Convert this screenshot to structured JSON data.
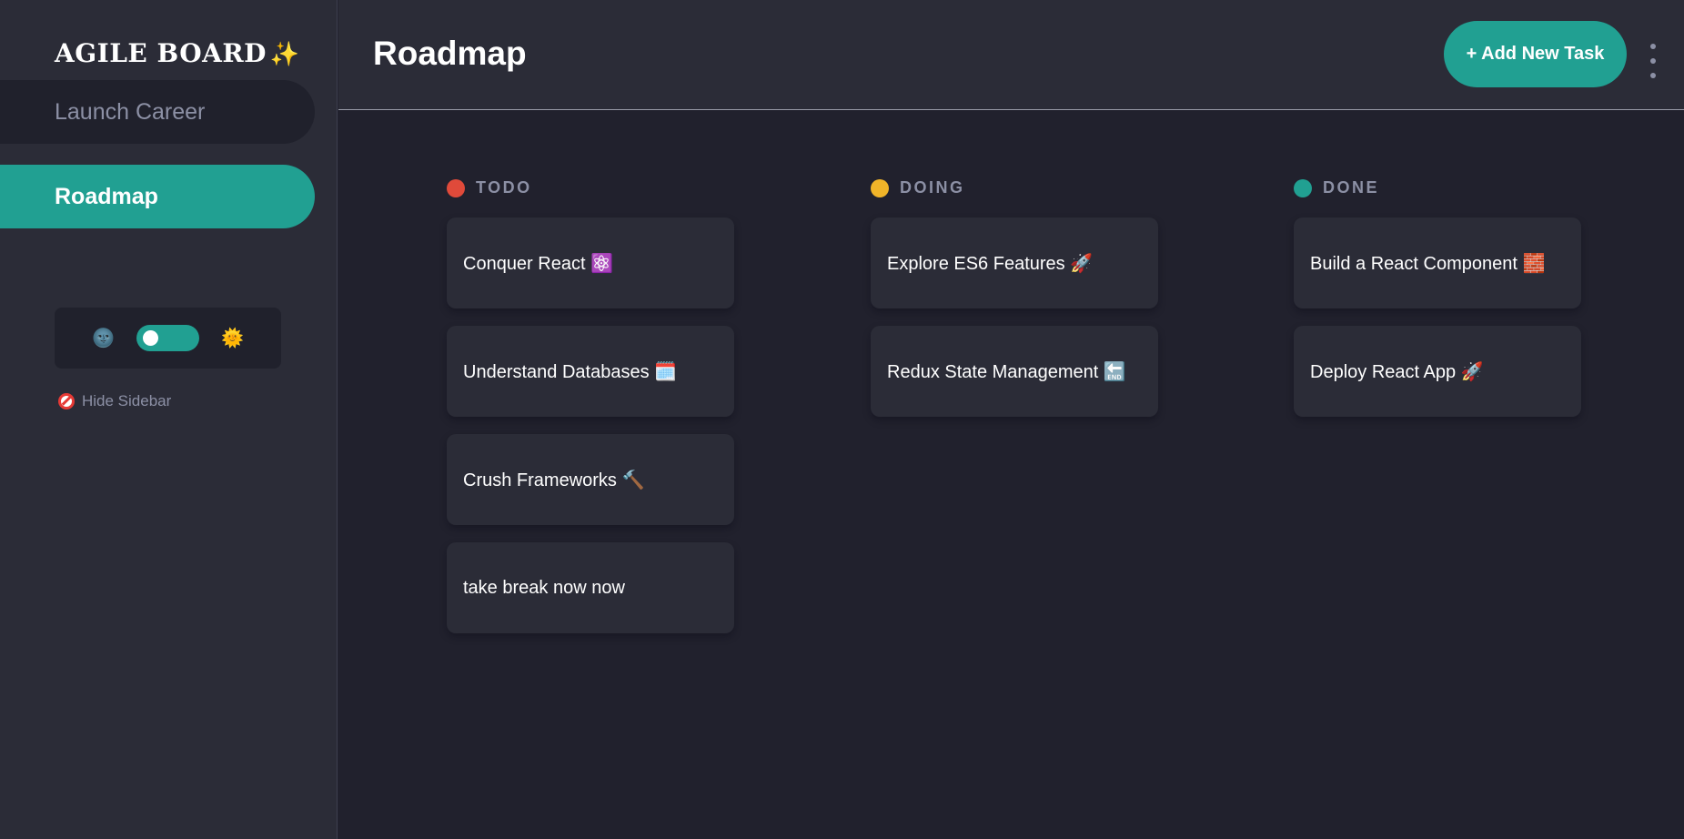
{
  "sidebar": {
    "logo_text": "AGILE BOARD",
    "logo_sparkle": "✨",
    "boards": [
      {
        "label": "Launch Career",
        "active": false
      },
      {
        "label": "Roadmap",
        "active": true
      }
    ],
    "theme": {
      "dark_icon": "🌚",
      "light_icon": "🌞",
      "dark_mode_on": true
    },
    "hide_label": "Hide Sidebar"
  },
  "header": {
    "title": "Roadmap",
    "add_task_label": "+ Add New Task"
  },
  "columns": [
    {
      "title": "TODO",
      "color": "#e04a3a",
      "tasks": [
        "Conquer React ⚛️",
        "Understand Databases 🗓️",
        "Crush Frameworks 🔨",
        "take break now now"
      ]
    },
    {
      "title": "DOING",
      "color": "#f0b429",
      "tasks": [
        "Explore ES6 Features 🚀",
        "Redux State Management 🔚"
      ]
    },
    {
      "title": "DONE",
      "color": "#21a092",
      "tasks": [
        "Build a React Component 🧱",
        "Deploy React App 🚀"
      ]
    }
  ],
  "colors": {
    "accent": "#21a092",
    "background": "#21212d",
    "panel": "#2b2c37",
    "muted_text": "#8c90a5"
  }
}
